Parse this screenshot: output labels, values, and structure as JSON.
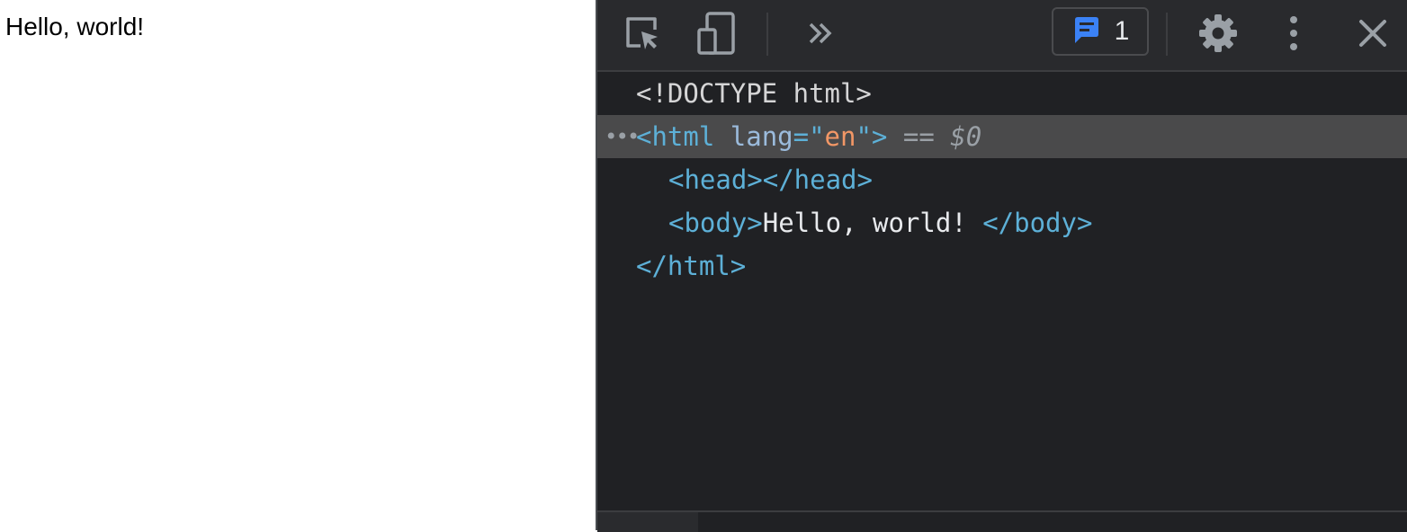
{
  "page": {
    "body_text": "Hello, world!"
  },
  "devtools": {
    "toolbar": {
      "inspect_icon": "inspect-element-icon",
      "device_icon": "device-toolbar-icon",
      "more_tabs_icon": "chevron-double-right-icon",
      "issues_icon": "message-icon",
      "issues_count": "1",
      "settings_icon": "gear-icon",
      "menu_icon": "kebab-menu-icon",
      "close_icon": "close-icon"
    },
    "tree": {
      "doctype": "<!DOCTYPE html>",
      "html_open_tag": "<html",
      "html_attr_name": "lang",
      "html_attr_eq": "=\"",
      "html_attr_value": "en",
      "html_attr_close": "\">",
      "selected_marker": "==",
      "selected_ref": "$0",
      "head_tag": "<head></head>",
      "body_open": "<body>",
      "body_text": "Hello, world! ",
      "body_close": "</body>",
      "html_close": "</html>",
      "ellipsis": "•••"
    },
    "colors": {
      "background": "#202124",
      "toolbar": "#292a2d",
      "selected_row": "#4a4a4b",
      "tag": "#5db0d7",
      "attr_value": "#f29766",
      "issues_icon": "#3b82f6"
    }
  }
}
